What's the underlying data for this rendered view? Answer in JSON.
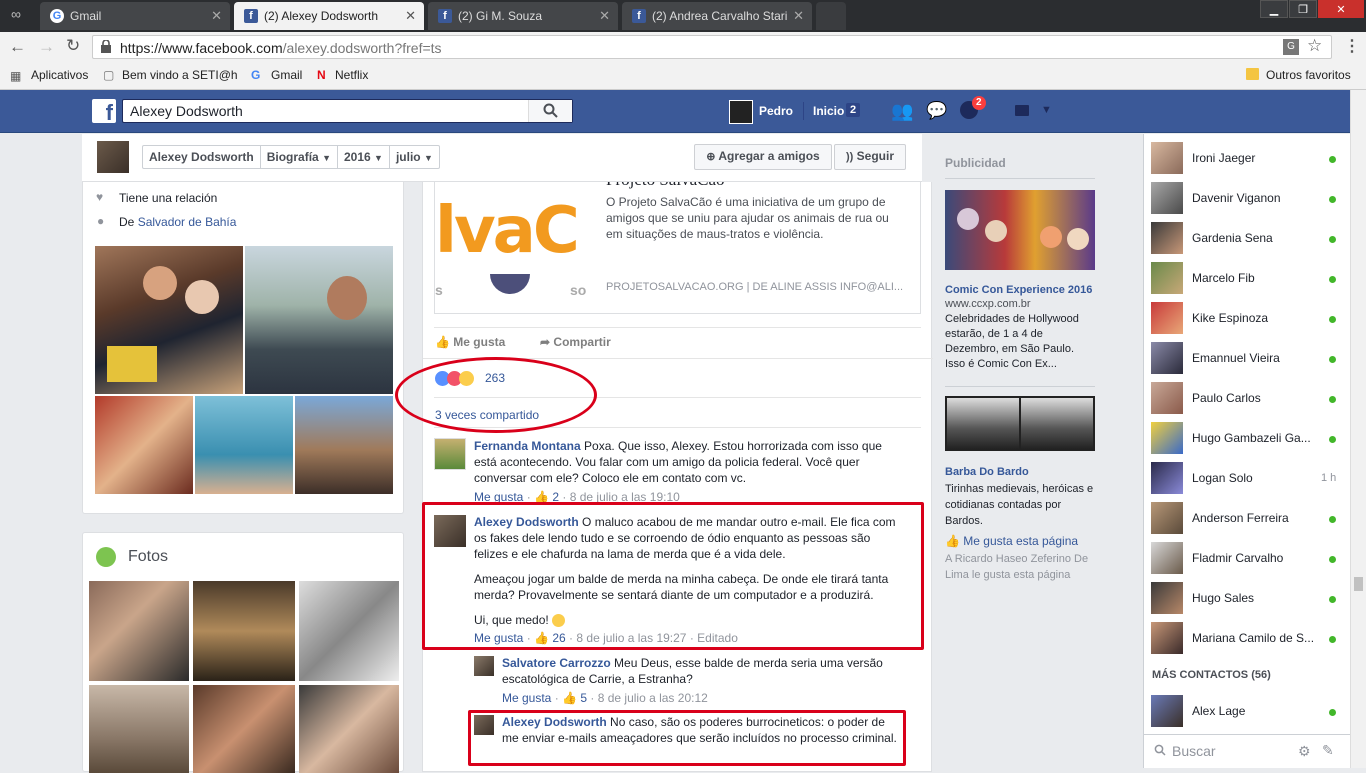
{
  "browser": {
    "tabs": [
      {
        "label": "Gmail",
        "icon": "google-g-icon"
      },
      {
        "label": "(2) Alexey Dodsworth",
        "icon": "facebook-f-icon"
      },
      {
        "label": "(2) Gi M. Souza",
        "icon": "facebook-f-icon"
      },
      {
        "label": "(2) Andrea Carvalho Stari",
        "icon": "facebook-f-icon"
      }
    ],
    "url_host": "https://www.facebook.com",
    "url_path": "/alexey.dodsworth?fref=ts",
    "bookmarks": [
      "Aplicativos",
      "Bem vindo a SETI@ho",
      "Gmail",
      "Netflix"
    ],
    "other_bookmarks": "Outros favoritos"
  },
  "fbbar": {
    "search_value": "Alexey Dodsworth",
    "user": "Pedro",
    "home": "Inicio",
    "home_count": "2",
    "notif_count": "2"
  },
  "profile_nav": {
    "name": "Alexey Dodsworth",
    "biografia": "Biografía",
    "year": "2016",
    "month": "julio",
    "add_friend": "Agregar a amigos",
    "follow": "Seguir"
  },
  "intro": {
    "relationship": "Tiene una relación",
    "from_prefix": "De",
    "from_place": "Salvador de Bahía"
  },
  "photos": {
    "title": "Fotos"
  },
  "post": {
    "link_title": "Projeto SalvaCão",
    "link_desc": "O Projeto SalvaCão é uma iniciativa de um grupo de amigos que se uniu para ajudar os animais de rua ou em situações de maus-tratos e violência.",
    "link_source": "PROJETOSALVACAO.ORG  |  DE ALINE ASSIS INFO@ALI...",
    "like_label": "Me gusta",
    "share_label": "Compartir",
    "reactions_count": "263",
    "shares": "3 veces compartido"
  },
  "comments": [
    {
      "author": "Fernanda Montana",
      "text": "Poxa. Que isso, Alexey. Estou horrorizada com isso que está acontecendo. Vou falar com um amigo da policia federal. Você quer conversar com ele? Coloco ele em contato com vc.",
      "like": "Me gusta",
      "likes": "2",
      "time": "8 de julio a las 19:10"
    },
    {
      "author": "Alexey Dodsworth",
      "text": "O maluco acabou de me mandar outro e-mail. Ele fica com os fakes dele lendo tudo e se corroendo de ódio enquanto as pessoas são felizes e ele chafurda na lama de merda que é a vida dele.",
      "text2": "Ameaçou jogar um balde de merda na minha cabeça. De onde ele tirará tanta merda? Provavelmente se sentará diante de um computador e a produzirá.",
      "text3": "Ui, que medo!",
      "like": "Me gusta",
      "likes": "26",
      "time": "8 de julio a las 19:27",
      "edited": "Editado"
    },
    {
      "author": "Salvatore Carrozzo",
      "text": "Meu Deus, esse balde de merda seria uma versão escatológica de Carrie, a Estranha?",
      "like": "Me gusta",
      "likes": "5",
      "time": "8 de julio a las 20:12"
    },
    {
      "author": "Alexey Dodsworth",
      "text": "No caso, são os poderes burrocineticos: o poder de me enviar e-mails ameaçadores que serão incluídos no processo criminal."
    }
  ],
  "ads": {
    "header": "Publicidad",
    "ad1_title": "Comic Con Experience 2016",
    "ad1_url": "www.ccxp.com.br",
    "ad1_text": "Celebridades de Hollywood estarão, de 1 a 4 de Dezembro, em São Paulo. Isso é Comic Con Ex...",
    "ad2_title": "Barba Do Bardo",
    "ad2_text": "Tirinhas medievais, heróicas e cotidianas contadas por Bardos.",
    "ad2_like": "Me gusta esta página",
    "ad2_social": "A Ricardo Haseo Zeferino De Lima le gusta esta página"
  },
  "chat": {
    "contacts": [
      {
        "name": "Ironi Jaeger",
        "status": "online"
      },
      {
        "name": "Davenir Viganon",
        "status": "online"
      },
      {
        "name": "Gardenia Sena",
        "status": "online"
      },
      {
        "name": "Marcelo Fib",
        "status": "online"
      },
      {
        "name": "Kike Espinoza",
        "status": "online"
      },
      {
        "name": "Emannuel Vieira",
        "status": "online"
      },
      {
        "name": "Paulo Carlos",
        "status": "online"
      },
      {
        "name": "Hugo Gambazeli Ga...",
        "status": "online"
      },
      {
        "name": "Logan Solo",
        "status": "1 h"
      },
      {
        "name": "Anderson Ferreira",
        "status": "online"
      },
      {
        "name": "Fladmir Carvalho",
        "status": "online"
      },
      {
        "name": "Hugo Sales",
        "status": "online"
      },
      {
        "name": "Mariana Camilo de S...",
        "status": "online"
      }
    ],
    "more_header": "MÁS CONTACTOS (56)",
    "more": [
      {
        "name": "Alex Lage",
        "status": "online"
      }
    ],
    "search_placeholder": "Buscar"
  },
  "colors": {
    "fb_blue": "#3b5998",
    "link": "#365899",
    "online": "#42b72a",
    "annotation_red": "#d9001a"
  }
}
